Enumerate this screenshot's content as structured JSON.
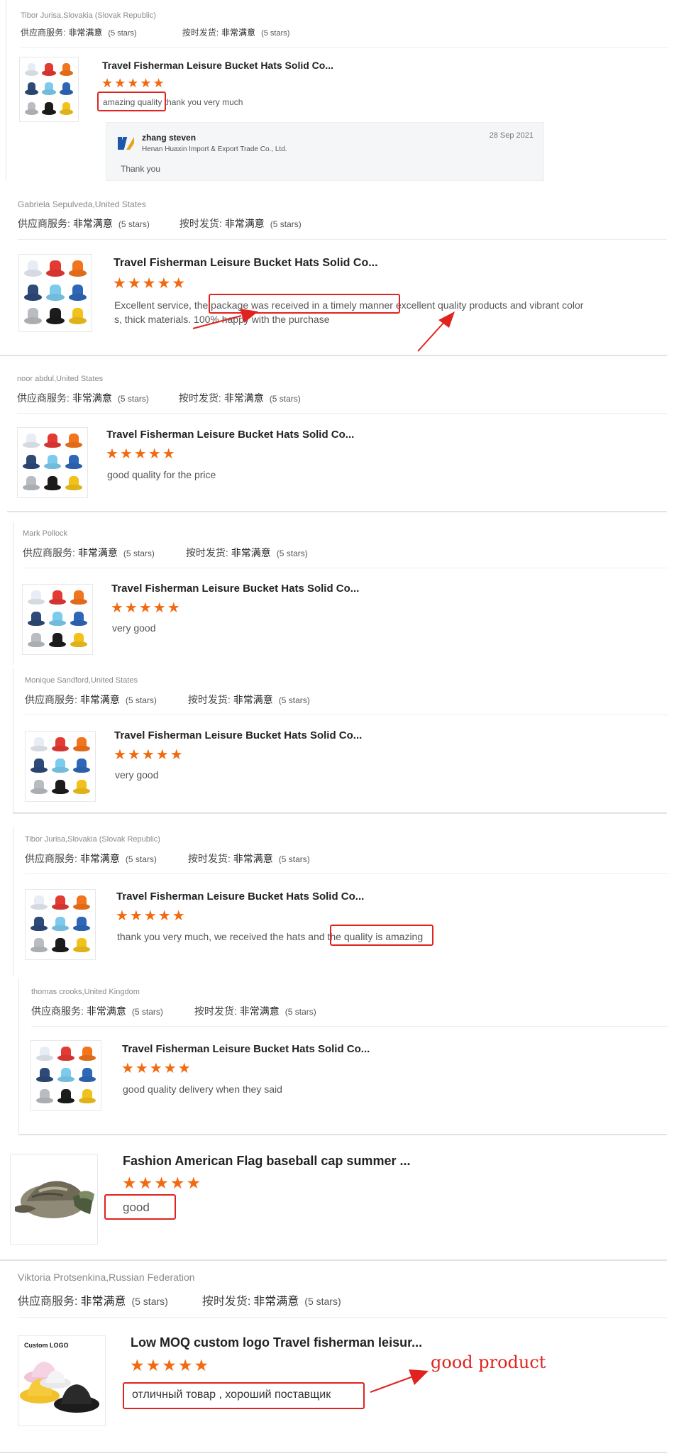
{
  "common": {
    "supplier_service_label": "供应商服务:",
    "delivery_label": "按时发货:",
    "rating_value": "非常满意",
    "five_stars_note": "(5 stars)",
    "stars_glyphs": "★★★★★",
    "hat_product_title": "Travel Fisherman Leisure Bucket Hats Solid Co..."
  },
  "hat_colors": [
    "#e8edf5",
    "#e43a34",
    "#f2741c",
    "#2d4a78",
    "#7ccbee",
    "#2e67b8",
    "#b9bcc0",
    "#1c1c1c",
    "#f2c21b"
  ],
  "reviews": [
    {
      "reviewer": "Tibor Jurisa,Slovakia (Slovak Republic)",
      "text": "amazing quality thank you very much",
      "reply": {
        "name": "zhang steven",
        "company": "Henan Huaxin Import & Export Trade Co., Ltd.",
        "date": "28 Sep 2021",
        "text": "Thank you"
      }
    },
    {
      "reviewer": "Gabriela Sepulveda,United States",
      "text_line1": "Excellent service, the package was received in a timely manner excellent quality products and vibrant color",
      "text_line2": "s, thick materials. 100% happy with the purchase"
    },
    {
      "reviewer": "noor abdul,United States",
      "text": "good quality for the price"
    },
    {
      "reviewer": "Mark Pollock",
      "text": "very good"
    },
    {
      "reviewer": "Monique Sandford,United States",
      "text": "very good"
    },
    {
      "reviewer": "Tibor Jurisa,Slovakia (Slovak Republic)",
      "text": "thank you very much, we received the hats and the quality is amazing"
    },
    {
      "reviewer": "thomas crooks,United Kingdom",
      "text": "good quality delivery when they said"
    },
    {
      "product_title": "Fashion American Flag baseball cap summer ...",
      "text": "good"
    },
    {
      "reviewer": "Viktoria Protsenkina,Russian Federation",
      "product_title": "Low MOQ custom logo Travel fisherman leisur...",
      "text": "отличный товар , хороший поставщик",
      "annotation": "good product",
      "thumb_label": "Custom LOGO"
    }
  ],
  "colors": {
    "star": "#f26a10",
    "highlight_red": "#e0231e"
  }
}
